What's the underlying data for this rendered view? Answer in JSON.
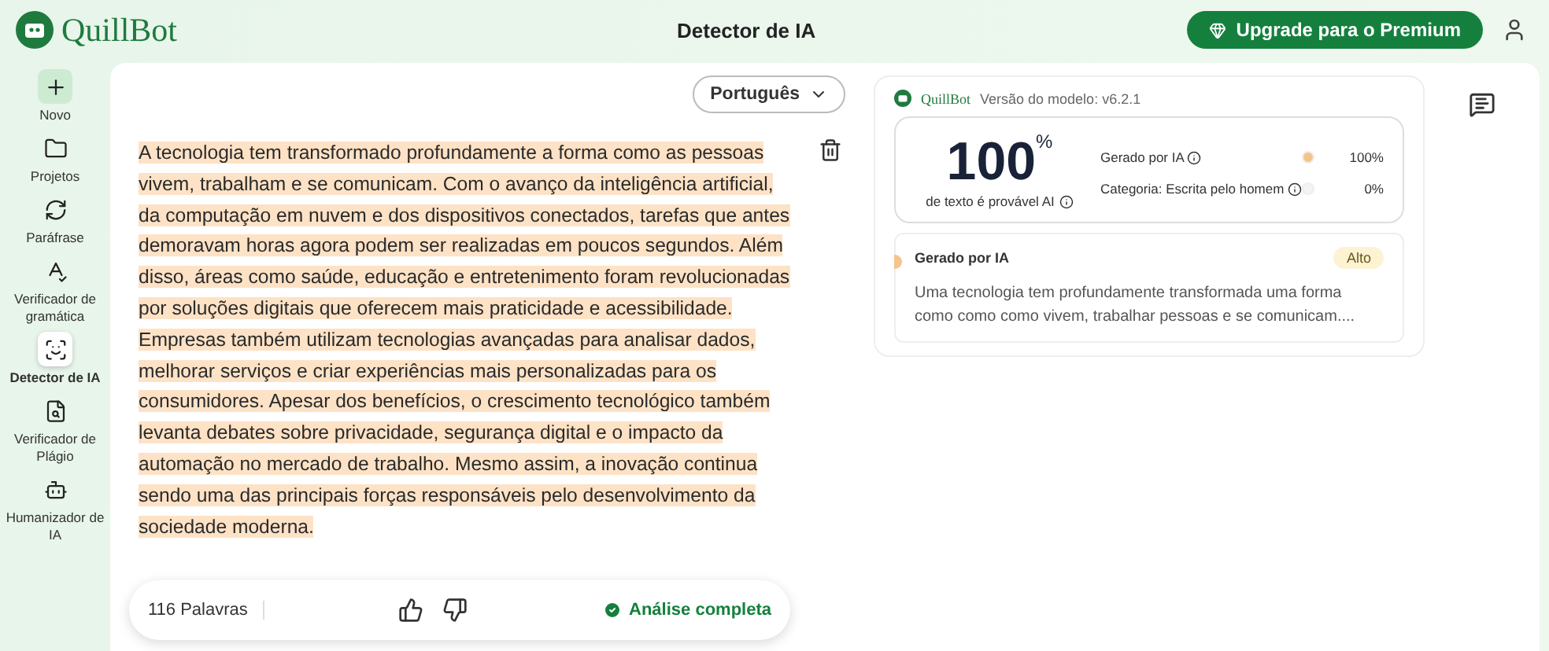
{
  "header": {
    "brand": "QuillBot",
    "title": "Detector de IA",
    "upgrade_button": "Upgrade para o Premium"
  },
  "sidebar": {
    "items": [
      {
        "label": "Novo",
        "selected": false
      },
      {
        "label": "Projetos",
        "selected": false
      },
      {
        "label": "Paráfrase",
        "selected": false
      },
      {
        "label": "Verificador de gramática",
        "selected": false
      },
      {
        "label": "Detector de IA",
        "selected": true
      },
      {
        "label": "Verificador de Plágio",
        "selected": false
      },
      {
        "label": "Humanizador de IA",
        "selected": false
      }
    ]
  },
  "editor": {
    "language": "Português",
    "highlighted": true,
    "text": "A tecnologia tem transformado profundamente a forma como as pessoas vivem, trabalham e se comunicam. Com o avanço da inteligência artificial, da computação em nuvem e dos dispositivos conectados, tarefas que antes demoravam horas agora podem ser realizadas em poucos segundos. Além disso, áreas como saúde, educação e entretenimento foram revolucionadas por soluções digitais que oferecem mais praticidade e acessibilidade. Empresas também utilizam tecnologias avançadas para analisar dados, melhorar serviços e criar experiências mais personalizadas para os consumidores. Apesar dos benefícios, o crescimento tecnológico também levanta debates sobre privacidade, segurança digital e o impacto da automação no mercado de trabalho. Mesmo assim, a inovação continua sendo uma das principais forças responsáveis pelo desenvolvimento da sociedade moderna.",
    "word_count": "116 Palavras",
    "status": "Análise completa"
  },
  "results": {
    "brand": "QuillBot",
    "model_version": "Versão do modelo: v6.2.1",
    "score": "100",
    "score_unit": "%",
    "score_caption": "de texto é provável AI",
    "categories": [
      {
        "label": "Gerado por IA",
        "color": "#f5c48c",
        "value": "100%"
      },
      {
        "label": "Categoria: Escrita pelo homem",
        "color": "#f4f4f4",
        "value": "0%"
      }
    ],
    "segment": {
      "label": "Gerado por IA",
      "badge": "Alto",
      "color": "#f5c48c",
      "text": "Uma tecnologia tem profundamente transformada uma forma como como como vivem, trabalhar pessoas e se comunicam...."
    }
  }
}
